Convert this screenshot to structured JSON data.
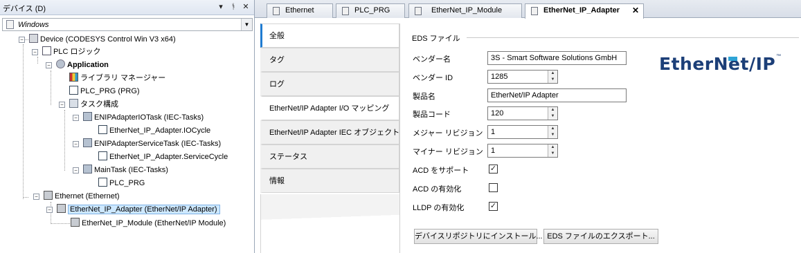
{
  "device_panel": {
    "title": "デバイス (D)",
    "pin_glyph": "▾",
    "dock_glyph": "ᚬ",
    "close_glyph": "✕",
    "combo_value": "Windows",
    "combo_arrow": "▼",
    "tree": [
      {
        "label": "Device (CODESYS Control Win V3 x64)"
      },
      {
        "label": "PLC ロジック"
      },
      {
        "label": "Application"
      },
      {
        "label": "ライブラリ マネージャー"
      },
      {
        "label": "PLC_PRG (PRG)"
      },
      {
        "label": "タスク構成"
      },
      {
        "label": "ENIPAdapterIOTask (IEC-Tasks)"
      },
      {
        "label": "EtherNet_IP_Adapter.IOCycle"
      },
      {
        "label": "ENIPAdapterServiceTask (IEC-Tasks)"
      },
      {
        "label": "EtherNet_IP_Adapter.ServiceCycle"
      },
      {
        "label": "MainTask (IEC-Tasks)"
      },
      {
        "label": "PLC_PRG"
      },
      {
        "label": "Ethernet (Ethernet)"
      },
      {
        "label": "EtherNet_IP_Adapter (EtherNet/IP Adapter)"
      },
      {
        "label": "EtherNet_IP_Module (EtherNet/IP Module)"
      }
    ]
  },
  "tabs": [
    {
      "label": "Ethernet"
    },
    {
      "label": "PLC_PRG"
    },
    {
      "label": "EtherNet_IP_Module"
    },
    {
      "label": "EtherNet_IP_Adapter",
      "close": "✕"
    }
  ],
  "nav": [
    {
      "label": "全般"
    },
    {
      "label": "タグ"
    },
    {
      "label": "ログ"
    },
    {
      "label": "EtherNet/IP Adapter I/O マッピング"
    },
    {
      "label": "EtherNet/IP Adapter IEC オブジェクト"
    },
    {
      "label": "ステータス"
    },
    {
      "label": "情報"
    }
  ],
  "eds": {
    "section_title": "EDS ファイル",
    "vendor_name_label": "ベンダー名",
    "vendor_name": "3S - Smart Software Solutions GmbH",
    "vendor_id_label": "ベンダー ID",
    "vendor_id": "1285",
    "product_name_label": "製品名",
    "product_name": "EtherNet/IP Adapter",
    "product_code_label": "製品コード",
    "product_code": "120",
    "major_rev_label": "メジャー リビジョン",
    "major_rev": "1",
    "minor_rev_label": "マイナー リビジョン",
    "minor_rev": "1",
    "acd_support_label": "ACD をサポート",
    "acd_support": true,
    "acd_enable_label": "ACD の有効化",
    "acd_enable": false,
    "lldp_enable_label": "LLDP の有効化",
    "lldp_enable": true,
    "check_glyph": "✓",
    "spin_up": "▲",
    "spin_down": "▼",
    "install_button": "デバイスリポジトリにインストール...",
    "export_button": "EDS ファイルのエクスポート..."
  },
  "logo": {
    "text": "EtherNet/IP",
    "tm": "™"
  },
  "tree_glyphs": {
    "collapse": "−"
  }
}
